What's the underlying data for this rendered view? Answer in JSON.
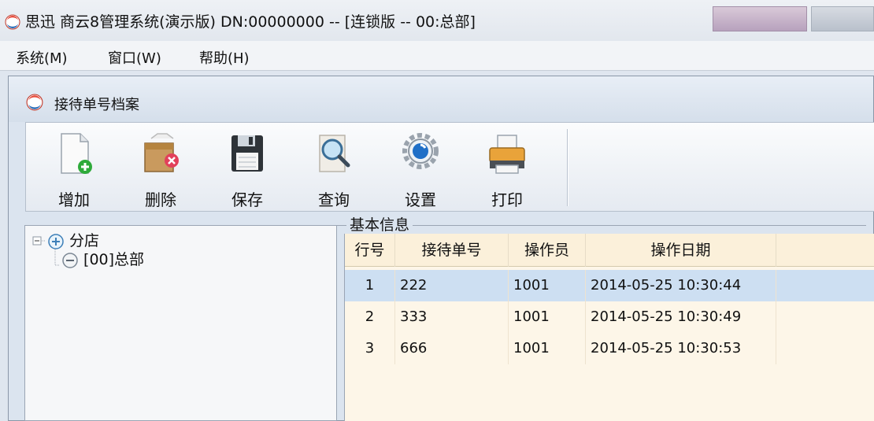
{
  "window": {
    "title": "思迅 商云8管理系统(演示版) DN:00000000 -- [连锁版 -- 00:总部]"
  },
  "menu": [
    {
      "label": "系统(M)"
    },
    {
      "label": "窗口(W)"
    },
    {
      "label": "帮助(H)"
    }
  ],
  "child": {
    "title": "接待单号档案"
  },
  "toolbar": {
    "add": "增加",
    "delete": "删除",
    "save": "保存",
    "query": "查询",
    "settings": "设置",
    "print": "打印"
  },
  "tree": {
    "root": "分店",
    "child": "[00]总部"
  },
  "group": {
    "title": "基本信息"
  },
  "table": {
    "headers": [
      "行号",
      "接待单号",
      "操作员",
      "操作日期"
    ],
    "rows": [
      {
        "row": "1",
        "no": "222",
        "operator": "1001",
        "date": "2014-05-25 10:30:44"
      },
      {
        "row": "2",
        "no": "333",
        "operator": "1001",
        "date": "2014-05-25 10:30:49"
      },
      {
        "row": "3",
        "no": "666",
        "operator": "1001",
        "date": "2014-05-25 10:30:53"
      }
    ]
  },
  "colors": {
    "selected_row": "#cddff2",
    "grid_bg": "#fdf6e8"
  },
  "icons": {
    "app": "app-logo-icon",
    "add": "new-document-icon",
    "delete": "delete-box-icon",
    "save": "floppy-disk-icon",
    "query": "magnifier-icon",
    "settings": "gear-icon",
    "print": "printer-icon"
  }
}
